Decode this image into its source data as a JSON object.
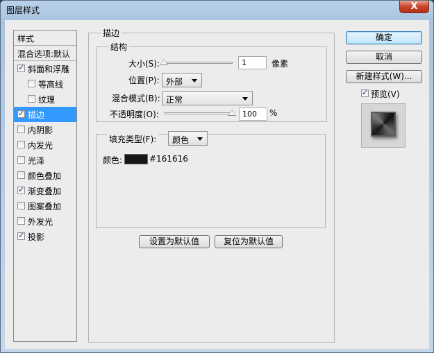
{
  "window": {
    "title": "图层样式",
    "close": "X"
  },
  "list": {
    "header": "样式",
    "blend_options": "混合选项:默认",
    "items": [
      {
        "label": "斜面和浮雕",
        "checked": true,
        "indent": false,
        "selected": false
      },
      {
        "label": "等高线",
        "checked": false,
        "indent": true,
        "selected": false
      },
      {
        "label": "纹理",
        "checked": false,
        "indent": true,
        "selected": false
      },
      {
        "label": "描边",
        "checked": true,
        "indent": false,
        "selected": true
      },
      {
        "label": "内阴影",
        "checked": false,
        "indent": false,
        "selected": false
      },
      {
        "label": "内发光",
        "checked": false,
        "indent": false,
        "selected": false
      },
      {
        "label": "光泽",
        "checked": false,
        "indent": false,
        "selected": false
      },
      {
        "label": "颜色叠加",
        "checked": false,
        "indent": false,
        "selected": false
      },
      {
        "label": "渐变叠加",
        "checked": true,
        "indent": false,
        "selected": false
      },
      {
        "label": "图案叠加",
        "checked": false,
        "indent": false,
        "selected": false
      },
      {
        "label": "外发光",
        "checked": false,
        "indent": false,
        "selected": false
      },
      {
        "label": "投影",
        "checked": true,
        "indent": false,
        "selected": false
      }
    ]
  },
  "stroke": {
    "title": "描边",
    "structure": {
      "title": "结构",
      "size_label": "大小(S):",
      "size_value": "1",
      "size_unit": "像素",
      "position_label": "位置(P):",
      "position_value": "外部",
      "blend_label": "混合模式(B):",
      "blend_value": "正常",
      "opacity_label": "不透明度(O):",
      "opacity_value": "100",
      "opacity_unit": "%"
    },
    "fill": {
      "type_label": "填充类型(F):",
      "type_value": "颜色",
      "color_label": "颜色:",
      "color_hex": "#161616"
    },
    "set_default": "设置为默认值",
    "reset_default": "复位为默认值"
  },
  "buttons": {
    "ok": "确定",
    "cancel": "取消",
    "new_style": "新建样式(W)...",
    "preview_label": "预览(V)"
  },
  "colors": {
    "selection": "#3399ff",
    "swatch": "#161616"
  }
}
